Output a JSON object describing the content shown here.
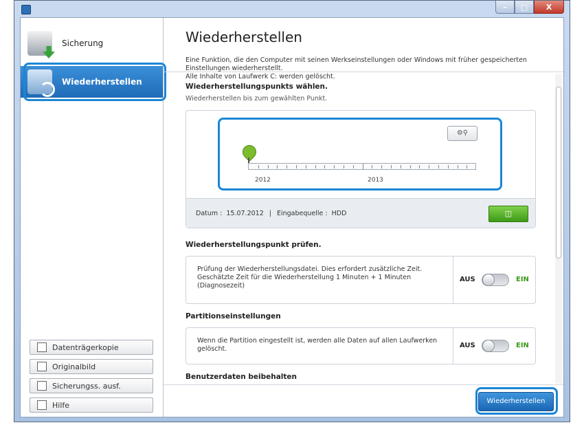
{
  "window": {
    "controls": {
      "minimize": "–",
      "maximize": "□",
      "close": "X"
    }
  },
  "sidebar": {
    "items": [
      {
        "label": "Sicherung"
      },
      {
        "label": "Wiederherstellen"
      }
    ],
    "buttons": [
      {
        "label": "Datenträgerkopie"
      },
      {
        "label": "Originalbild"
      },
      {
        "label": "Sicherungss. ausf."
      },
      {
        "label": "Hilfe"
      }
    ]
  },
  "header": {
    "title": "Wiederherstellen",
    "description": "Eine Funktion, die den Computer mit seinen Werkseinstellungen oder Windows mit früher gespeicherten Einstellungen wiederherstellt.",
    "warning": "Alle Inhalte von Laufwerk C: werden gelöscht."
  },
  "restore_point": {
    "title": "Wiederherstellungspunkts wählen.",
    "subtitle": "Wiederherstellen bis zum gewählten Punkt.",
    "years": [
      "2012",
      "2013"
    ],
    "date_label": "Datum :",
    "date_value": "15.07.2012",
    "separator": "|",
    "source_label": "Eingabequelle :",
    "source_value": "HDD"
  },
  "verify": {
    "title": "Wiederherstellungspunkt prüfen.",
    "text": "Prüfung der Wiederherstellungsdatei. Dies erfordert zusätzliche Zeit. Geschätzte Zeit für die Wiederherstellung 1 Minuten + 1 Minuten (Diagnosezeit)",
    "off_label": "AUS",
    "on_label": "EIN"
  },
  "partition": {
    "title": "Partitionseinstellungen",
    "text": "Wenn die Partition eingestellt ist, werden alle Daten auf allen Laufwerken gelöscht.",
    "off_label": "AUS",
    "on_label": "EIN"
  },
  "userdata": {
    "title": "Benutzerdaten beibehalten"
  },
  "footer": {
    "button_label": "Wiederherstellen"
  }
}
